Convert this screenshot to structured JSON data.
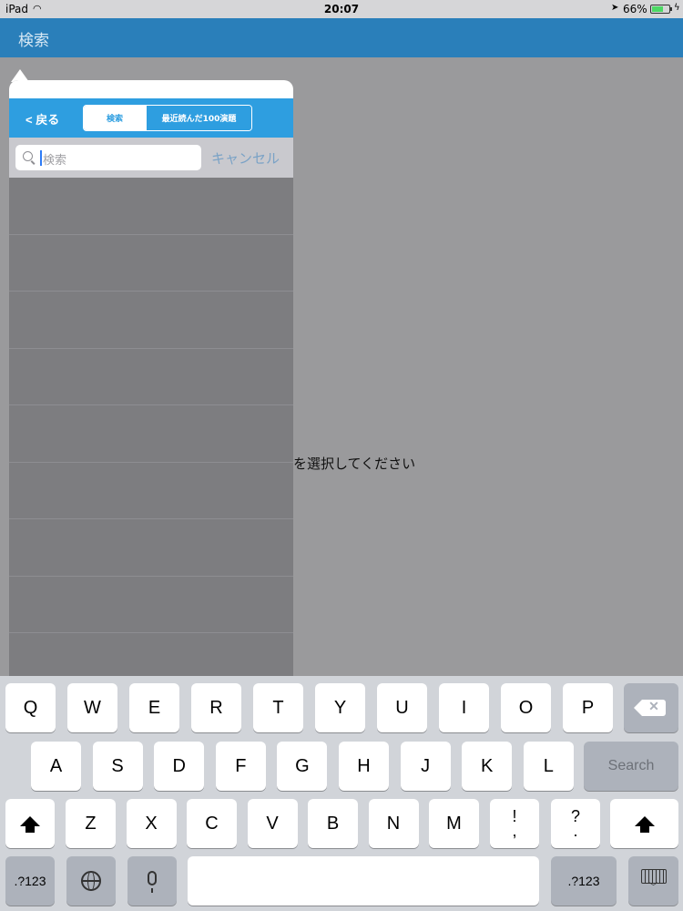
{
  "status_bar": {
    "carrier": "iPad",
    "time": "20:07",
    "battery_percent": "66%",
    "battery_level": 0.66
  },
  "nav": {
    "title": "検索"
  },
  "main": {
    "placeholder_message": "を選択してください"
  },
  "popover": {
    "back_label": "< 戻る",
    "segments": [
      "検索",
      "最近読んだ100演題"
    ],
    "selected_segment": 0,
    "search": {
      "placeholder": "検索",
      "value": ""
    },
    "cancel_label": "キャンセル",
    "row_count": 9
  },
  "keyboard": {
    "row1": [
      "Q",
      "W",
      "E",
      "R",
      "T",
      "Y",
      "U",
      "I",
      "O",
      "P"
    ],
    "row2": [
      "A",
      "S",
      "D",
      "F",
      "G",
      "H",
      "J",
      "K",
      "L"
    ],
    "row3": [
      "Z",
      "X",
      "C",
      "V",
      "B",
      "N",
      "M"
    ],
    "punct_1": [
      "!",
      ","
    ],
    "punct_2": [
      "?",
      "."
    ],
    "search_label": "Search",
    "numbers_label": ".?123",
    "icons": {
      "delete": "delete-icon",
      "shift": "shift-icon",
      "globe": "globe-icon",
      "microphone": "microphone-icon",
      "hide_keyboard": "keyboard-hide-icon"
    }
  },
  "colors": {
    "nav_bar": "#2a7fba",
    "popover_nav": "#2e9ee0",
    "dim_background": "#9a9a9c",
    "keyboard_bg": "#d1d4d9"
  }
}
